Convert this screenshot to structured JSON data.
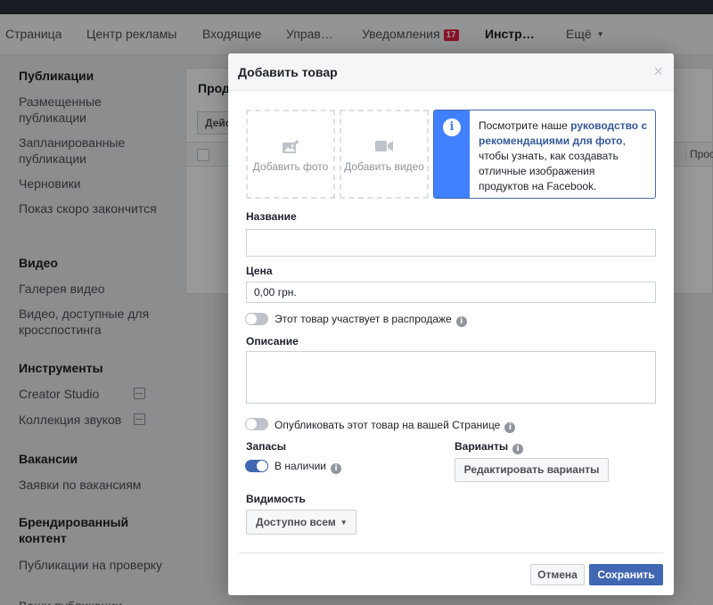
{
  "nav": {
    "items": [
      "Страница",
      "Центр рекламы",
      "Входящие",
      "Управ…"
    ],
    "notifications_label": "Уведомления",
    "notifications_count": "17",
    "tools_label": "Инстр…",
    "more_label": "Ещё"
  },
  "sidebar": {
    "sections": [
      {
        "title": "Публикации",
        "items": [
          "Размещенные публикации",
          "Запланированные публикации",
          "Черновики",
          "Показ скоро закончится"
        ]
      },
      {
        "title": "Видео",
        "items": [
          "Галерея видео",
          "Видео, доступные для кросспостинга"
        ]
      },
      {
        "title": "Инструменты",
        "items": [
          "Creator Studio",
          "Коллекция звуков"
        ]
      },
      {
        "title": "Вакансии",
        "items": [
          "Заявки по вакансиям"
        ]
      },
      {
        "title": "Брендированный контент",
        "items": [
          "Публикации на проверку",
          "Ваши публикации"
        ]
      }
    ]
  },
  "background_panel": {
    "title": "Прод",
    "action_button": "Дейс",
    "column_header": "Прос"
  },
  "modal": {
    "title": "Добавить товар",
    "close": "×",
    "add_photo": "Добавить фото",
    "add_video": "Добавить видео",
    "info_text_before": "Посмотрите наше ",
    "info_link": "руководство с рекомендациями для фото",
    "info_text_after": ", чтобы узнать, как создавать отличные изображения продуктов на Facebook.",
    "name_label": "Название",
    "name_value": "",
    "price_label": "Цена",
    "price_value": "0,00 грн.",
    "sale_toggle_label": "Этот товар участвует в распродаже",
    "sale_toggle_on": false,
    "description_label": "Описание",
    "description_value": "",
    "publish_toggle_label": "Опубликовать этот товар на вашей Странице",
    "publish_toggle_on": false,
    "stock_label": "Запасы",
    "stock_toggle_label": "В наличии",
    "stock_toggle_on": true,
    "variants_label": "Варианты",
    "edit_variants_button": "Редактировать варианты",
    "visibility_label": "Видимость",
    "visibility_value": "Доступно всем",
    "cancel_button": "Отмена",
    "save_button": "Сохранить"
  },
  "colors": {
    "accent": "#4267b2",
    "info_strip": "#4080ff",
    "badge": "#e41e3f"
  }
}
